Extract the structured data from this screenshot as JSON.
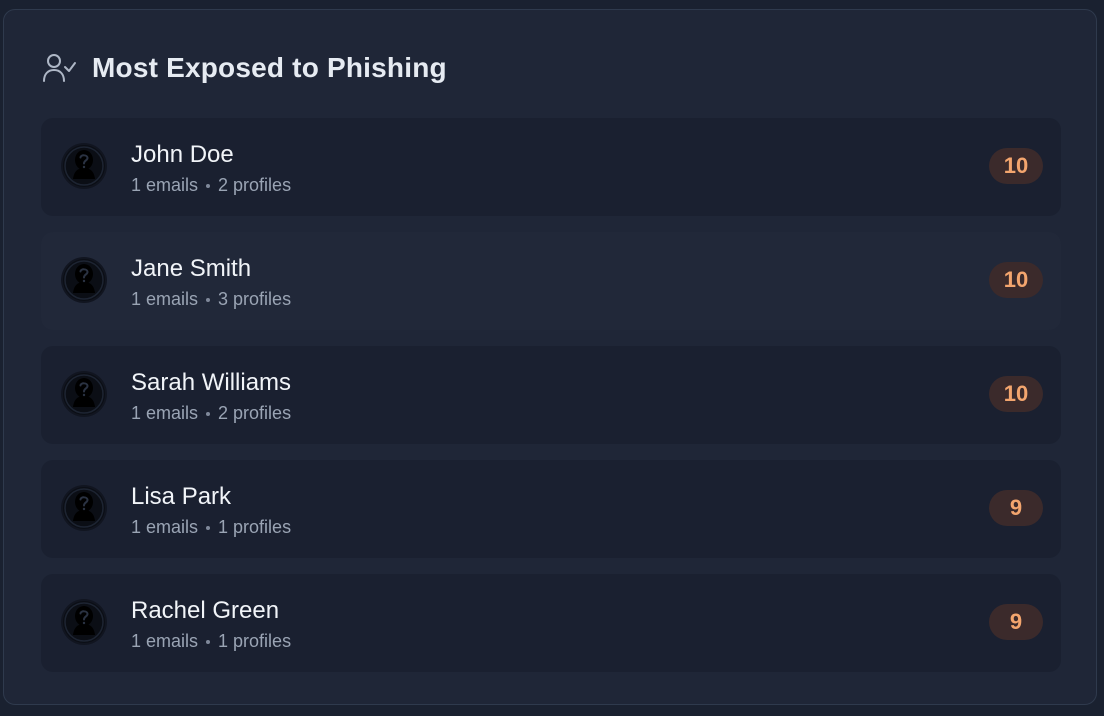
{
  "panel": {
    "title": "Most Exposed to Phishing",
    "icon": "user-check-icon"
  },
  "people": [
    {
      "name": "John Doe",
      "emails": "1 emails",
      "profiles": "2 profiles",
      "score": "10"
    },
    {
      "name": "Jane Smith",
      "emails": "1 emails",
      "profiles": "3 profiles",
      "score": "10"
    },
    {
      "name": "Sarah Williams",
      "emails": "1 emails",
      "profiles": "2 profiles",
      "score": "10"
    },
    {
      "name": "Lisa Park",
      "emails": "1 emails",
      "profiles": "1 profiles",
      "score": "9"
    },
    {
      "name": "Rachel Green",
      "emails": "1 emails",
      "profiles": "1 profiles",
      "score": "9"
    }
  ],
  "colors": {
    "background": "#1a2130",
    "card": "#1f2637",
    "row": "#1a2030",
    "badge_bg": "#3b2a2b",
    "badge_text": "#f3a56e"
  }
}
